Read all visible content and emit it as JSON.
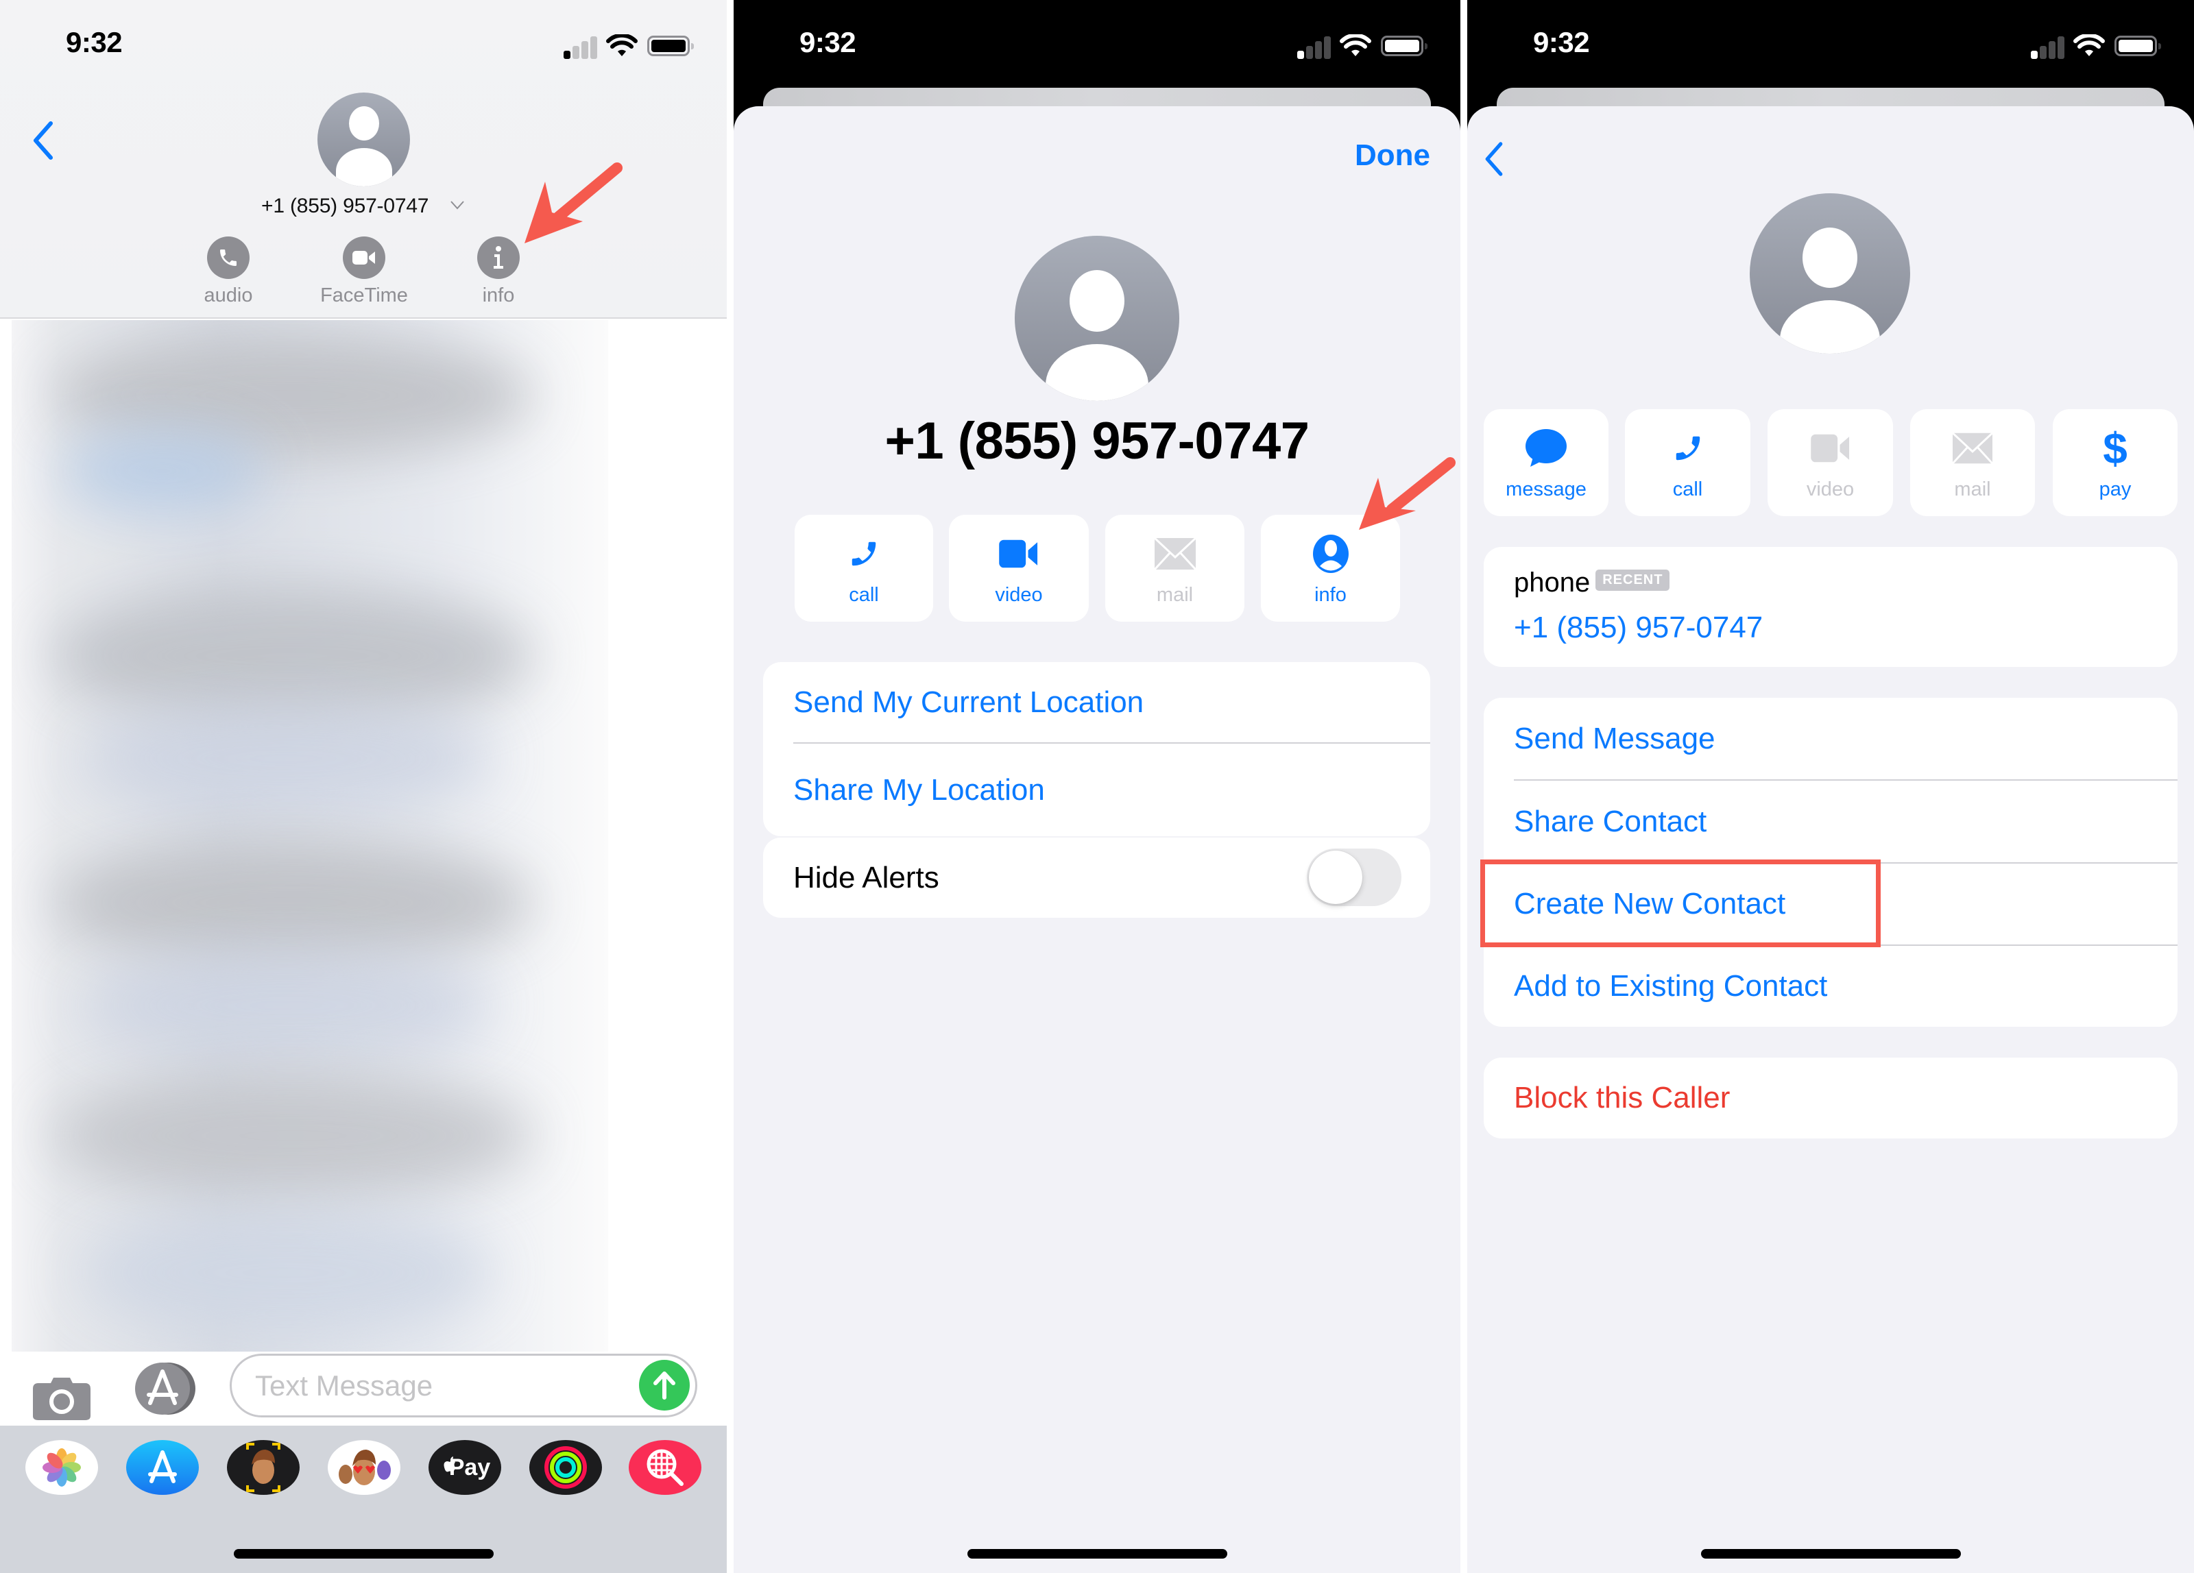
{
  "status_bar": {
    "time": "9:32"
  },
  "panel_messages": {
    "contact_number": "+1 (855) 957-0747",
    "header_actions": [
      {
        "label": "audio",
        "icon": "phone-icon"
      },
      {
        "label": "FaceTime",
        "icon": "video-camera-icon"
      },
      {
        "label": "info",
        "icon": "info-icon"
      }
    ],
    "input": {
      "placeholder": "Text Message",
      "value": ""
    },
    "app_drawer": [
      {
        "name": "Photos",
        "icon": "photos-icon"
      },
      {
        "name": "App Store",
        "icon": "app-store-icon"
      },
      {
        "name": "Memoji",
        "icon": "memoji-icon"
      },
      {
        "name": "Memoji Stickers",
        "icon": "memoji-stickers-icon"
      },
      {
        "name": "Apple Pay",
        "icon": "apple-pay-icon",
        "text": "Pay"
      },
      {
        "name": "Activity",
        "icon": "activity-rings-icon"
      },
      {
        "name": "Images Search",
        "icon": "globe-search-icon"
      }
    ]
  },
  "panel_details": {
    "done_label": "Done",
    "contact_number": "+1 (855) 957-0747",
    "quick_actions": [
      {
        "label": "call",
        "icon": "phone-icon",
        "enabled": true
      },
      {
        "label": "video",
        "icon": "video-camera-icon",
        "enabled": true
      },
      {
        "label": "mail",
        "icon": "envelope-icon",
        "enabled": false
      },
      {
        "label": "info",
        "icon": "person-circle-icon",
        "enabled": true
      }
    ],
    "location_rows": [
      "Send My Current Location",
      "Share My Location"
    ],
    "hide_alerts": {
      "label": "Hide Alerts",
      "on": false
    }
  },
  "panel_contact": {
    "quick_actions": [
      {
        "label": "message",
        "icon": "message-bubble-icon",
        "enabled": true
      },
      {
        "label": "call",
        "icon": "phone-icon",
        "enabled": true
      },
      {
        "label": "video",
        "icon": "video-camera-icon",
        "enabled": false
      },
      {
        "label": "mail",
        "icon": "envelope-icon",
        "enabled": false
      },
      {
        "label": "pay",
        "icon": "dollar-icon",
        "enabled": true
      }
    ],
    "phone": {
      "label": "phone",
      "badge": "RECENT",
      "number": "+1 (855) 957-0747"
    },
    "actions": [
      "Send Message",
      "Share Contact",
      "Create New Contact",
      "Add to Existing Contact"
    ],
    "highlighted_action": "Create New Contact",
    "block_label": "Block this Caller"
  },
  "colors": {
    "accent_blue": "#0a7aff",
    "destructive_red": "#eb3b30",
    "annotation_red": "#f55a4e",
    "send_green": "#34c759"
  }
}
